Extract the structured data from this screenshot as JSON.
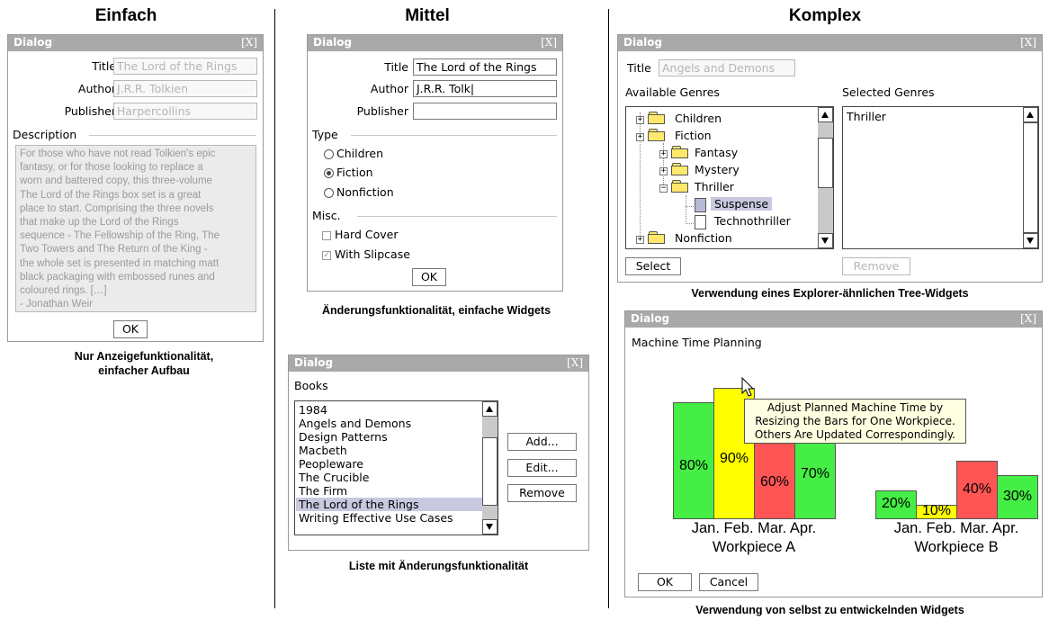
{
  "columns": {
    "simple": "Einfach",
    "medium": "Mittel",
    "complex": "Komplex"
  },
  "captions": {
    "simple": [
      "Nur Anzeigefunktionalität,",
      "einfacher Aufbau"
    ],
    "medium_top": "Änderungsfunktionalität, einfache Widgets",
    "medium_bottom": "Liste mit Änderungsfunktionalität",
    "complex_top": "Verwendung eines Explorer-ähnlichen Tree-Widgets",
    "complex_bottom": "Verwendung von selbst zu entwickelnden Widgets"
  },
  "dialog_title": "Dialog",
  "close_label": "[X]",
  "ok_label": "OK",
  "simple_dialog": {
    "title_label": "Title",
    "title_value": "The Lord of the Rings",
    "author_label": "Author",
    "author_value": "J.R.R. Tolkien",
    "publisher_label": "Publisher",
    "publisher_value": "Harpercollins",
    "description_label": "Description",
    "description_lines": [
      "For those who have not read Tolkien's epic",
      "fantasy, or for those looking to replace a",
      "worn and battered copy, this three-volume",
      "The Lord of the Rings box set is a great",
      "place to start. Comprising the three novels",
      "that make up the Lord of the Rings",
      "sequence - The Fellowship of the Ring, The",
      "Two Towers and The Return of the King -",
      "the whole set is presented in matching matt",
      "black packaging with embossed runes and",
      "coloured rings. […]",
      "- Jonathan Weir"
    ]
  },
  "edit_dialog": {
    "title_label": "Title",
    "title_value": "The Lord of the Rings",
    "author_label": "Author",
    "author_value": "J.R.R. Tolk|",
    "publisher_label": "Publisher",
    "publisher_value": "",
    "type_label": "Type",
    "type_options": [
      "Children",
      "Fiction",
      "Nonfiction"
    ],
    "type_selected": "Fiction",
    "misc_label": "Misc.",
    "misc_options": [
      {
        "label": "Hard Cover",
        "checked": false
      },
      {
        "label": "With Slipcase",
        "checked": true
      }
    ]
  },
  "list_dialog": {
    "books_label": "Books",
    "books": [
      "1984",
      "Angels and Demons",
      "Design Patterns",
      "Macbeth",
      "Peopleware",
      "The Crucible",
      "The Firm",
      "The Lord of the Rings",
      "Writing Effective Use Cases"
    ],
    "selected_book": "The Lord of the Rings",
    "add_label": "Add...",
    "edit_label": "Edit...",
    "remove_label": "Remove"
  },
  "tree_dialog": {
    "title_label": "Title",
    "title_value": "Angels and Demons",
    "available_label": "Available Genres",
    "selected_label": "Selected Genres",
    "tree": [
      "Children",
      "Fiction",
      "Fantasy",
      "Mystery",
      "Thriller",
      "Suspense",
      "Technothriller",
      "Nonfiction"
    ],
    "selected_node": "Suspense",
    "selected_genres": [
      "Thriller"
    ],
    "select_label": "Select",
    "remove_label": "Remove"
  },
  "planning_dialog": {
    "heading": "Machine Time Planning",
    "tooltip_lines": [
      "Adjust Planned Machine Time by",
      "Resizing the Bars for One Workpiece.",
      "Others Are Updated Correspondingly."
    ],
    "cancel_label": "Cancel",
    "colors": {
      "green": "#44ee44",
      "yellow": "#ffff00",
      "red": "#ff5555"
    },
    "chart_data": {
      "type": "bar",
      "categories": [
        "Jan.",
        "Feb.",
        "Mar.",
        "Apr."
      ],
      "series": [
        {
          "name": "Workpiece A",
          "values": [
            80,
            90,
            60,
            70
          ],
          "labels": [
            "80%",
            "90%",
            "60%",
            "70%"
          ]
        },
        {
          "name": "Workpiece B",
          "values": [
            20,
            10,
            40,
            30
          ],
          "labels": [
            "20%",
            "10%",
            "40%",
            "30%"
          ]
        }
      ],
      "bar_colors": [
        "#44ee44",
        "#ffff00",
        "#ff5555",
        "#44ee44"
      ]
    }
  }
}
